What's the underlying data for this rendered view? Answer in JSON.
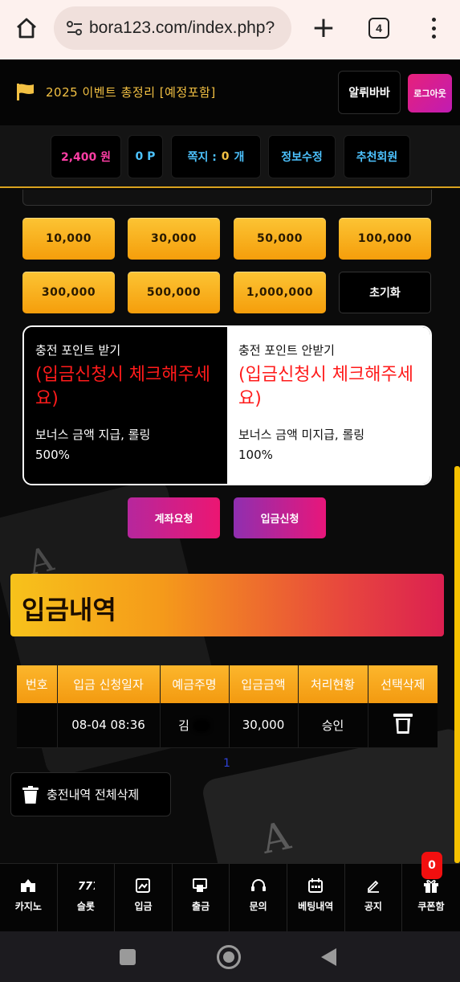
{
  "browser": {
    "url": "bora123.com/index.php?",
    "tab_count": "4"
  },
  "header": {
    "event_title": "2025 이벤트 총정리 [예정포함]",
    "username": "알뤼바바",
    "logout_label": "로그아웃"
  },
  "info_bar": {
    "money": "2,400 원",
    "point": "0 P",
    "message_label": "쪽지 :",
    "message_count": "0",
    "message_unit": "개",
    "edit_label": "정보수정",
    "recommend_label": "추천회원"
  },
  "amounts": [
    "10,000",
    "30,000",
    "50,000",
    "100,000",
    "300,000",
    "500,000",
    "1,000,000"
  ],
  "reset_label": "초기화",
  "options": {
    "receive": {
      "title": "충전 포인트 받기",
      "warning": "(입금신청시 체크해주세요)",
      "desc_line1": "보너스 금액 지급, 롤링",
      "desc_line2": "500%"
    },
    "no_receive": {
      "title": "충전 포인트 안받기",
      "warning": "(입금신청시 체크해주세요)",
      "desc_line1": "보너스 금액 미지급, 롤링",
      "desc_line2": "100%"
    }
  },
  "actions": {
    "account_request": "계좌요청",
    "deposit_request": "입금신청"
  },
  "history": {
    "title": "입금내역",
    "columns": [
      "번호",
      "입금 신청일자",
      "예금주명",
      "입금금액",
      "처리현황",
      "선택삭제"
    ],
    "rows": [
      {
        "no": "",
        "date": "08-04 08:36",
        "name": "김",
        "amount": "30,000",
        "status": "승인"
      }
    ],
    "page": "1",
    "clear_all_label": "충전내역 전체삭제"
  },
  "bottom_nav": [
    {
      "label": "카지노",
      "icon": "casino-icon"
    },
    {
      "label": "슬롯",
      "icon": "slot-icon"
    },
    {
      "label": "입금",
      "icon": "deposit-icon"
    },
    {
      "label": "출금",
      "icon": "withdraw-icon"
    },
    {
      "label": "문의",
      "icon": "headset-icon"
    },
    {
      "label": "베팅내역",
      "icon": "calendar-icon"
    },
    {
      "label": "공지",
      "icon": "pencil-icon"
    },
    {
      "label": "쿠폰함",
      "icon": "gift-icon"
    }
  ],
  "coupon_badge": "0",
  "colors": {
    "gold": "#f3c143",
    "pink": "#ff3ea5",
    "cyan": "#4dc3ff",
    "warning_red": "#ff1b1b"
  }
}
